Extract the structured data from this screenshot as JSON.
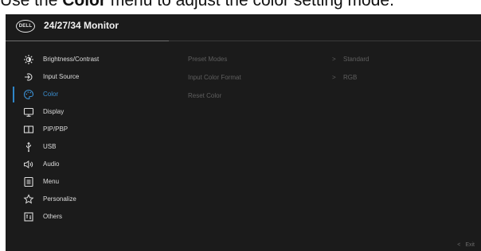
{
  "caption": {
    "before": "Use the ",
    "bold": "Color",
    "after": " menu to adjust the color setting mode."
  },
  "header": {
    "logo_text": "DELL",
    "title": "24/27/34 Monitor"
  },
  "menu": {
    "items": [
      {
        "label": "Brightness/Contrast",
        "icon": "brightness-icon"
      },
      {
        "label": "Input Source",
        "icon": "input-source-icon"
      },
      {
        "label": "Color",
        "icon": "color-icon",
        "active": true
      },
      {
        "label": "Display",
        "icon": "display-icon"
      },
      {
        "label": "PIP/PBP",
        "icon": "pip-pbp-icon"
      },
      {
        "label": "USB",
        "icon": "usb-icon"
      },
      {
        "label": "Audio",
        "icon": "audio-icon"
      },
      {
        "label": "Menu",
        "icon": "menu-icon"
      },
      {
        "label": "Personalize",
        "icon": "star-icon"
      },
      {
        "label": "Others",
        "icon": "others-icon"
      }
    ]
  },
  "submenu": {
    "rows": [
      {
        "label": "Preset Modes",
        "chevron": ">",
        "value": "Standard"
      },
      {
        "label": "Input Color Format",
        "chevron": ">",
        "value": "RGB"
      },
      {
        "label": "Reset Color",
        "chevron": "",
        "value": ""
      }
    ]
  },
  "footer": {
    "exit_chevron": "<",
    "exit_label": "Exit"
  },
  "colors": {
    "osd_background": "#1b1b1b",
    "accent": "#3b8fd1",
    "menu_text": "#dcdcdc",
    "disabled_text": "#5f5f5f"
  }
}
